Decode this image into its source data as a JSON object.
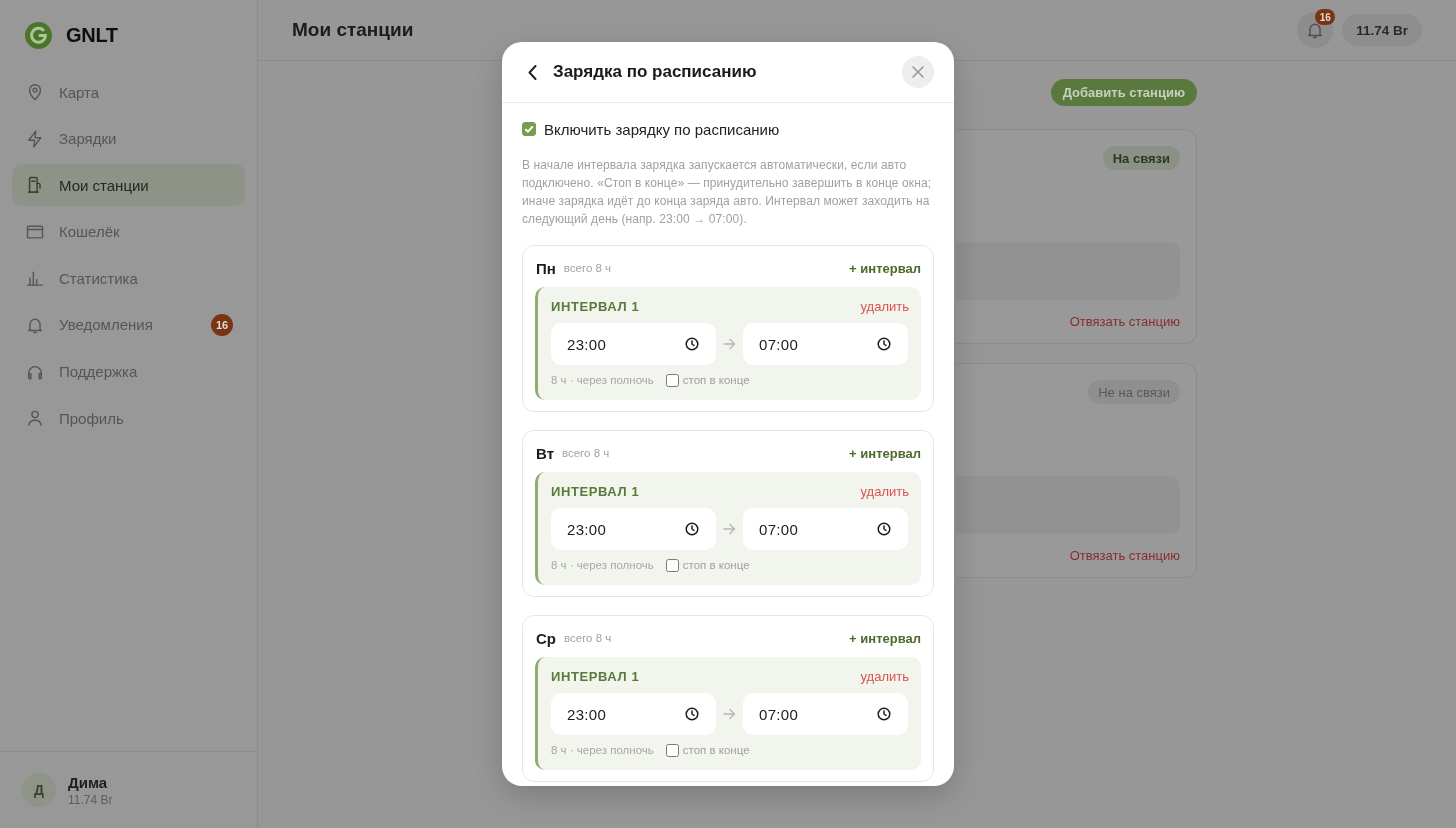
{
  "sidebar": {
    "logo": "GNLT",
    "items": [
      {
        "label": "Карта",
        "selected": false
      },
      {
        "label": "Зарядки",
        "selected": false
      },
      {
        "label": "Мои станции",
        "selected": true
      },
      {
        "label": "Кошелёк",
        "selected": false
      },
      {
        "label": "Статистика",
        "selected": false
      },
      {
        "label": "Уведомления",
        "selected": false,
        "badge": "16"
      },
      {
        "label": "Поддержка",
        "selected": false
      },
      {
        "label": "Профиль",
        "selected": false
      }
    ],
    "user": {
      "initial": "Д",
      "name": "Дима",
      "balance": "11.74 Br"
    }
  },
  "header": {
    "title": "Мои станции",
    "notifications_count": "16",
    "balance": "11.74 Br"
  },
  "stations_page": {
    "add_button": "Добавить станцию",
    "stations": [
      {
        "status": "На связи",
        "online": true,
        "unlink": "Отвязать станцию"
      },
      {
        "status": "Не на связи",
        "online": false,
        "unlink": "Отвязать станцию"
      }
    ]
  },
  "modal": {
    "title": "Зарядка по расписанию",
    "enable": {
      "label": "Включить зарядку по расписанию",
      "checked": true
    },
    "description": "В начале интервала зарядка запускается автоматически, если авто подключено. «Стоп в конце» — принудительно завершить в конце окна; иначе зарядка идёт до конца заряда авто. Интервал может заходить на следующий день (напр. 23:00 → 07:00).",
    "days": [
      {
        "day": "Пн",
        "total": "всего 8 ч",
        "add": "+ интервал",
        "intervals": [
          {
            "label": "ИНТЕРВАЛ 1",
            "delete": "удалить",
            "start": "23:00",
            "end": "07:00",
            "note": "8 ч · через полночь",
            "stop_label": "стоп в конце",
            "stop_at_end": false
          }
        ]
      },
      {
        "day": "Вт",
        "total": "всего 8 ч",
        "add": "+ интервал",
        "intervals": [
          {
            "label": "ИНТЕРВАЛ 1",
            "delete": "удалить",
            "start": "23:00",
            "end": "07:00",
            "note": "8 ч · через полночь",
            "stop_label": "стоп в конце",
            "stop_at_end": false
          }
        ]
      },
      {
        "day": "Ср",
        "total": "всего 8 ч",
        "add": "+ интервал",
        "intervals": [
          {
            "label": "ИНТЕРВАЛ 1",
            "delete": "удалить",
            "start": "23:00",
            "end": "07:00",
            "note": "8 ч · через полночь",
            "stop_label": "стоп в конце",
            "stop_at_end": false
          }
        ]
      }
    ]
  }
}
